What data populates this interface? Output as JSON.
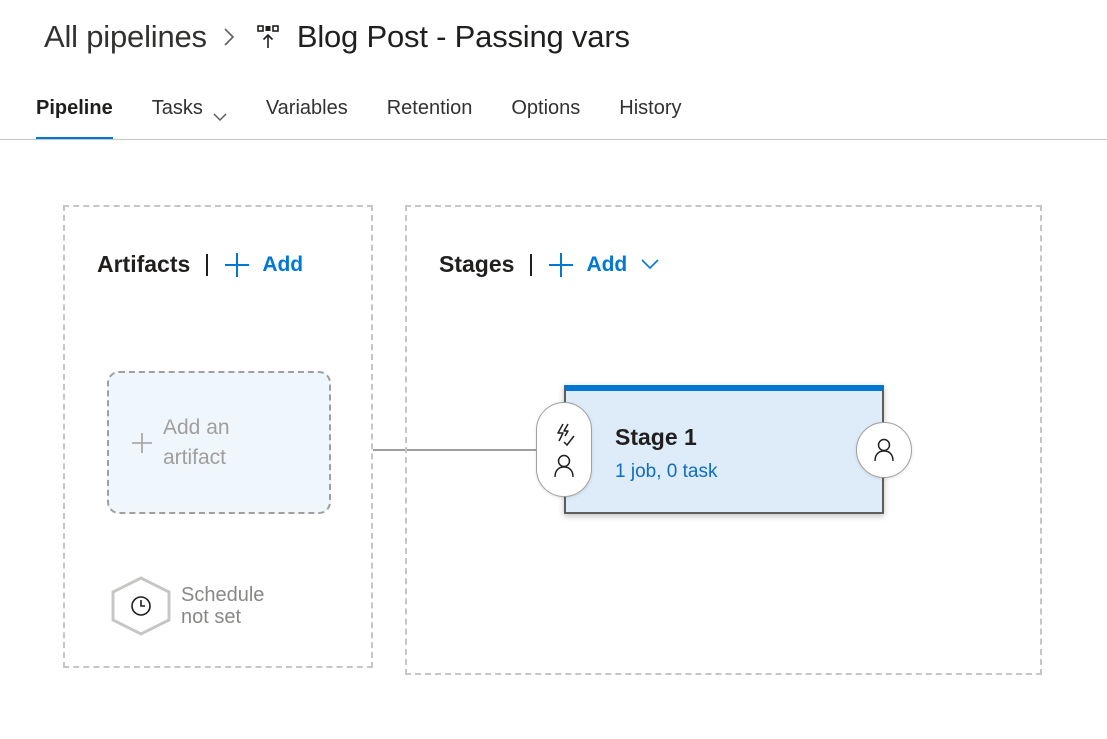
{
  "breadcrumb": {
    "root": "All pipelines",
    "separator_icon": "chevron-right-icon",
    "pipeline_icon": "release-pipeline-icon",
    "current": "Blog Post - Passing vars"
  },
  "tabs": [
    {
      "label": "Pipeline",
      "active": true
    },
    {
      "label": "Tasks",
      "active": false,
      "has_dropdown": true
    },
    {
      "label": "Variables",
      "active": false
    },
    {
      "label": "Retention",
      "active": false
    },
    {
      "label": "Options",
      "active": false
    },
    {
      "label": "History",
      "active": false
    }
  ],
  "artifacts": {
    "title": "Artifacts",
    "add_label": "Add",
    "add_card_label": "Add an artifact",
    "schedule_label": "Schedule not set"
  },
  "stages": {
    "title": "Stages",
    "add_label": "Add",
    "items": [
      {
        "name": "Stage 1",
        "summary": "1 job, 0 task"
      }
    ]
  },
  "colors": {
    "accent": "#0078d4",
    "stage_bg": "#deecf9",
    "artifact_card_bg": "#eff6fc",
    "link": "#106ebe"
  }
}
